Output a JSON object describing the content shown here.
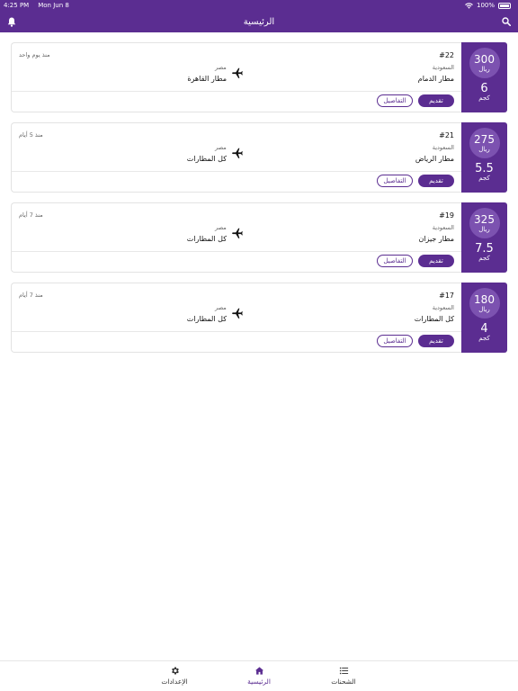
{
  "status_bar": {
    "time": "4:25 PM",
    "date": "Mon Jun 8",
    "battery": "100%"
  },
  "header": {
    "title": "الرئيسية"
  },
  "shipments": [
    {
      "number": "#22",
      "origin_country": "السعودية",
      "origin_airport": "مطار الدمام",
      "dest_country": "مصر",
      "dest_airport": "مطار القاهرة",
      "time_ago": "منذ يوم واحد",
      "price": "300",
      "currency": "ريال",
      "weight": "6",
      "weight_unit": "كجم",
      "apply_label": "تقديم",
      "details_label": "التفاصيل"
    },
    {
      "number": "#21",
      "origin_country": "السعودية",
      "origin_airport": "مطار الرياض",
      "dest_country": "مصر",
      "dest_airport": "كل المطارات",
      "time_ago": "منذ 5 أيام",
      "price": "275",
      "currency": "ريال",
      "weight": "5.5",
      "weight_unit": "كجم",
      "apply_label": "تقديم",
      "details_label": "التفاصيل"
    },
    {
      "number": "#19",
      "origin_country": "السعودية",
      "origin_airport": "مطار جيزان",
      "dest_country": "مصر",
      "dest_airport": "كل المطارات",
      "time_ago": "منذ 7 أيام",
      "price": "325",
      "currency": "ريال",
      "weight": "7.5",
      "weight_unit": "كجم",
      "apply_label": "تقديم",
      "details_label": "التفاصيل"
    },
    {
      "number": "#17",
      "origin_country": "السعودية",
      "origin_airport": "كل المطارات",
      "dest_country": "مصر",
      "dest_airport": "كل المطارات",
      "time_ago": "منذ 7 أيام",
      "price": "180",
      "currency": "ريال",
      "weight": "4",
      "weight_unit": "كجم",
      "apply_label": "تقديم",
      "details_label": "التفاصيل"
    }
  ],
  "tab_bar": {
    "settings": {
      "label": "الإعدادات",
      "icon": "gear-icon"
    },
    "home": {
      "label": "الرئيسية",
      "icon": "home-icon"
    },
    "shipments": {
      "label": "الشحنات",
      "icon": "list-icon"
    }
  },
  "colors": {
    "brand": "#5b2d91",
    "brand_light": "#7c52b0"
  }
}
